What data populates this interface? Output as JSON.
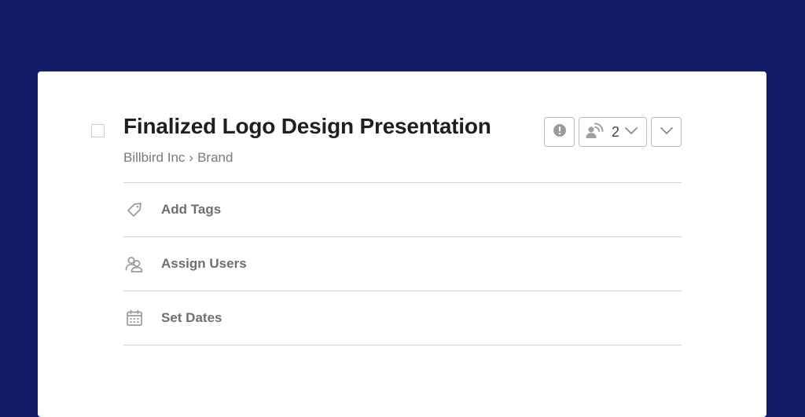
{
  "task": {
    "title": "Finalized Logo Design Presentation",
    "breadcrumb": {
      "project": "Billbird Inc",
      "separator": "›",
      "section": "Brand"
    }
  },
  "actions": {
    "priority_icon": "exclamation-circle-icon",
    "followers_icon": "follower-signal-icon",
    "followers_count": "2",
    "more_icon": "chevron-down-icon"
  },
  "rows": [
    {
      "label": "Add Tags",
      "icon": "tag-icon"
    },
    {
      "label": "Assign Users",
      "icon": "users-icon"
    },
    {
      "label": "Set Dates",
      "icon": "calendar-icon"
    }
  ],
  "colors": {
    "background": "#141c68",
    "card": "#ffffff",
    "title": "#1f1f1f",
    "muted": "#7a7a7a",
    "icon": "#9a9a9a"
  }
}
